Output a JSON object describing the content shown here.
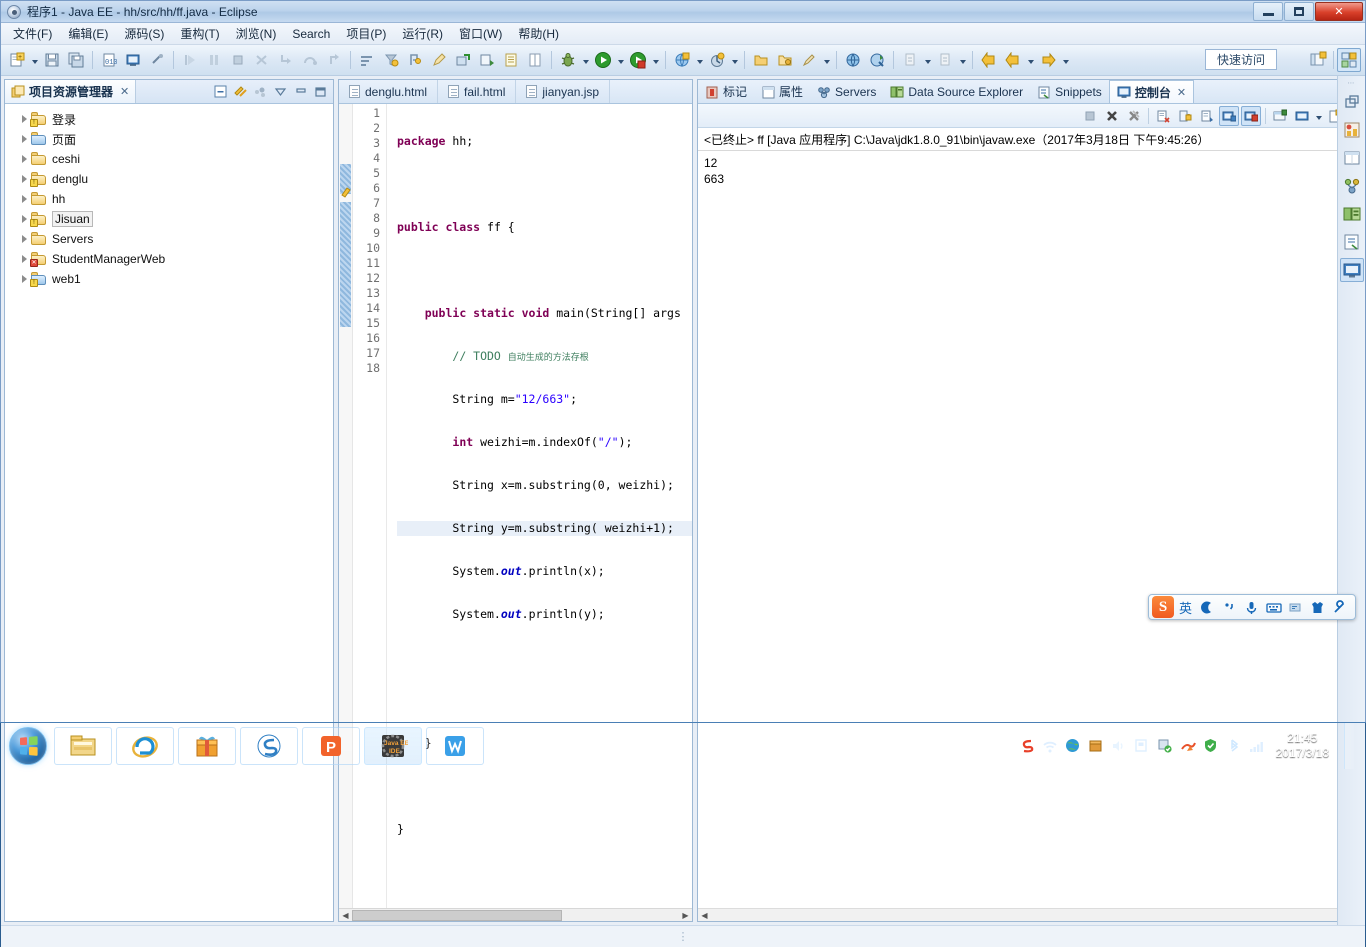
{
  "window": {
    "title": "程序1  -  Java EE  -  hh/src/hh/ff.java  -  Eclipse",
    "minimize_label": "最小化",
    "maximize_label": "最大化",
    "close_label": "关闭"
  },
  "menubar": {
    "items": [
      {
        "label": "文件(F)"
      },
      {
        "label": "编辑(E)"
      },
      {
        "label": "源码(S)"
      },
      {
        "label": "重构(T)"
      },
      {
        "label": "浏览(N)"
      },
      {
        "label": "Search"
      },
      {
        "label": "项目(P)"
      },
      {
        "label": "运行(R)"
      },
      {
        "label": "窗口(W)"
      },
      {
        "label": "帮助(H)"
      }
    ]
  },
  "toolbar": {
    "quick_access": "快速访问",
    "icons": [
      "new-wizard-icon",
      "save-icon",
      "save-all-icon",
      "new-java-class-icon",
      "console-view-icon",
      "link-break-icon",
      "debug-resume-icon",
      "debug-suspend-icon",
      "debug-terminate-icon",
      "debug-disconnect-icon",
      "step-into-icon",
      "step-over-icon",
      "step-return-icon",
      "open-type-icon",
      "open-task-icon",
      "annotation-icon",
      "pencil-icon",
      "external-tools-icon",
      "run-external-icon",
      "note-icon",
      "table-icon",
      "debug-icon",
      "run-icon",
      "coverage-icon",
      "server-icon",
      "profile-icon",
      "open-folder-icon",
      "open-package-icon",
      "brush-icon",
      "globe-icon",
      "search-java-icon",
      "next-annotation-icon",
      "previous-annotation-icon",
      "back-icon",
      "forward-arrow-icon",
      "forward-icon"
    ],
    "perspective_buttons": [
      "open-perspective-icon",
      "java-ee-perspective-icon"
    ]
  },
  "explorer": {
    "tab_label": "项目资源管理器",
    "tab_close": "✕",
    "tools": [
      "collapse-all-icon",
      "link-with-editor-icon",
      "view-menu-icon",
      "minimize-icon",
      "maximize-icon"
    ],
    "items": [
      {
        "label": "登录",
        "icon": "java-project-warning-icon",
        "type": "warn"
      },
      {
        "label": "页面",
        "icon": "web-project-icon",
        "type": "web"
      },
      {
        "label": "ceshi",
        "icon": "folder-icon",
        "type": "plain"
      },
      {
        "label": "denglu",
        "icon": "java-project-warning-icon",
        "type": "warn"
      },
      {
        "label": "hh",
        "icon": "folder-icon",
        "type": "plain"
      },
      {
        "label": "Jisuan",
        "icon": "java-project-warning-icon",
        "type": "warn",
        "selected": true
      },
      {
        "label": "Servers",
        "icon": "folder-icon",
        "type": "plain"
      },
      {
        "label": "StudentManagerWeb",
        "icon": "project-error-icon",
        "type": "err"
      },
      {
        "label": "web1",
        "icon": "web-project-warning-icon",
        "type": "warn"
      }
    ]
  },
  "editor": {
    "tabs": [
      {
        "label": "denglu.html",
        "icon": "html-file-icon",
        "active": false
      },
      {
        "label": "fail.html",
        "icon": "html-file-icon",
        "active": false
      },
      {
        "label": "jianyan.jsp",
        "icon": "jsp-file-icon",
        "active": false
      }
    ],
    "line_numbers": [
      "1",
      "2",
      "3",
      "4",
      "5",
      "6",
      "7",
      "8",
      "9",
      "10",
      "11",
      "12",
      "13",
      "14",
      "15",
      "16",
      "17",
      "18"
    ],
    "highlighted_line": 10,
    "folding_line": 5,
    "code_lines": [
      "package hh;",
      "",
      "public class ff {",
      "",
      "    public static void main(String[] args",
      "        // TODO 自动生成的方法存根",
      "        String m=\"12/663\";",
      "        int weizhi=m.indexOf(\"/\");",
      "        String x=m.substring(0, weizhi);",
      "        String y=m.substring( weizhi+1);",
      "        System.out.println(x);",
      "        System.out.println(y);",
      "",
      "",
      "    }",
      "",
      "}",
      ""
    ]
  },
  "console": {
    "tabs": [
      {
        "label": "标记",
        "icon": "marker-icon",
        "active": false
      },
      {
        "label": "属性",
        "icon": "properties-icon",
        "active": false
      },
      {
        "label": "Servers",
        "icon": "servers-icon",
        "active": false
      },
      {
        "label": "Data Source Explorer",
        "icon": "datasource-icon",
        "active": false
      },
      {
        "label": "Snippets",
        "icon": "snippets-icon",
        "active": false
      },
      {
        "label": "控制台",
        "icon": "console-icon",
        "active": true,
        "close": "✕"
      }
    ],
    "toolbar_icons": [
      "terminate-icon",
      "remove-launch-icon",
      "remove-all-launches-icon",
      "clear-console-icon",
      "lock-scroll-icon",
      "scroll-lock-icon",
      "show-console-on-output-icon",
      "show-console-on-error-icon",
      "pin-console-icon",
      "display-selected-console-icon",
      "open-console-icon"
    ],
    "header": "<已终止> ff [Java 应用程序] C:\\Java\\jdk1.8.0_91\\bin\\javaw.exe（2017年3月18日 下午9:45:26）",
    "output": "12\n663"
  },
  "fastview": {
    "icons": [
      "restore-icon",
      "markers-fastview-icon",
      "properties-fastview-icon",
      "servers-fastview-icon",
      "datasource-fastview-icon",
      "snippets-fastview-icon",
      "console-fastview-icon"
    ]
  },
  "ime": {
    "logo": "S",
    "items": [
      {
        "icon": "language-mode-icon",
        "label": "英"
      },
      {
        "icon": "moon-icon",
        "label": "☾"
      },
      {
        "icon": "punctuation-icon",
        "label": "°,"
      },
      {
        "icon": "microphone-icon",
        "label": "🎤"
      },
      {
        "icon": "soft-keyboard-icon",
        "label": "⌨"
      },
      {
        "icon": "input-method-icon",
        "label": "≡"
      },
      {
        "icon": "skin-icon",
        "label": "👕"
      },
      {
        "icon": "toolbox-icon",
        "label": "🔧"
      }
    ]
  },
  "taskbar": {
    "start_label": "开始",
    "buttons": [
      {
        "name": "file-explorer",
        "icon": "folder-taskbar-icon"
      },
      {
        "name": "internet-explorer",
        "icon": "ie-icon"
      },
      {
        "name": "media-app",
        "icon": "gift-icon"
      },
      {
        "name": "sogou-browser",
        "icon": "sogou-icon"
      },
      {
        "name": "wps-presentation",
        "icon": "wps-p-icon"
      },
      {
        "name": "eclipse-java-ee",
        "icon": "eclipse-icon",
        "active": true
      },
      {
        "name": "wps-writer",
        "icon": "wps-w-icon"
      }
    ],
    "tray": [
      {
        "name": "sogou-tray",
        "icon": "sogou-s-icon"
      },
      {
        "name": "wifi",
        "icon": "wifi-icon"
      },
      {
        "name": "network-globe",
        "icon": "globe-icon"
      },
      {
        "name": "package-update",
        "icon": "box-icon"
      },
      {
        "name": "volume",
        "icon": "speaker-icon"
      },
      {
        "name": "action-center",
        "icon": "flag-icon"
      },
      {
        "name": "sync",
        "icon": "shield-check-icon"
      },
      {
        "name": "thunder",
        "icon": "thunder-icon"
      },
      {
        "name": "security",
        "icon": "shield-icon"
      },
      {
        "name": "bluetooth",
        "icon": "bluetooth-icon"
      },
      {
        "name": "signal",
        "icon": "signal-icon"
      }
    ],
    "time": "21:45",
    "date": "2017/3/18"
  }
}
